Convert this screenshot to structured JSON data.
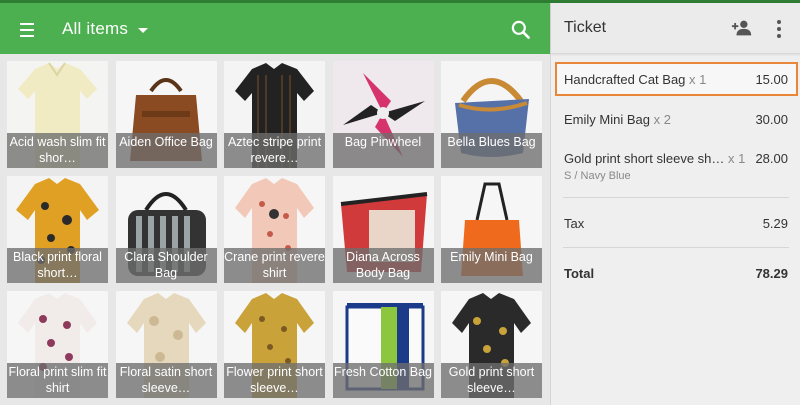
{
  "header": {
    "title": "All items"
  },
  "items": [
    {
      "label": "Acid wash slim fit shor…"
    },
    {
      "label": "Aiden Office Bag"
    },
    {
      "label": "Aztec stripe print revere…"
    },
    {
      "label": "Bag Pinwheel"
    },
    {
      "label": "Bella Blues Bag"
    },
    {
      "label": "Black print floral short…"
    },
    {
      "label": "Clara Shoulder Bag"
    },
    {
      "label": "Crane print revere shirt"
    },
    {
      "label": "Diana Across Body Bag"
    },
    {
      "label": "Emily Mini Bag"
    },
    {
      "label": "Floral print slim fit shirt"
    },
    {
      "label": "Floral satin short sleeve…"
    },
    {
      "label": "Flower print short sleeve…"
    },
    {
      "label": "Fresh Cotton Bag"
    },
    {
      "label": "Gold print short sleeve…"
    }
  ],
  "ticket": {
    "title": "Ticket",
    "lines": [
      {
        "name": "Handcrafted Cat Bag",
        "qty": "x 1",
        "amount": "15.00"
      },
      {
        "name": "Emily Mini Bag",
        "qty": "x 2",
        "amount": "30.00"
      },
      {
        "name": "Gold print short sleeve sh…",
        "qty": "x 1",
        "amount": "28.00",
        "variant": "S / Navy Blue"
      }
    ],
    "tax_label": "Tax",
    "tax_amount": "5.29",
    "total_label": "Total",
    "total_amount": "78.29"
  },
  "colors": {
    "appbar": "#4caf50",
    "selection": "#e8873a"
  }
}
